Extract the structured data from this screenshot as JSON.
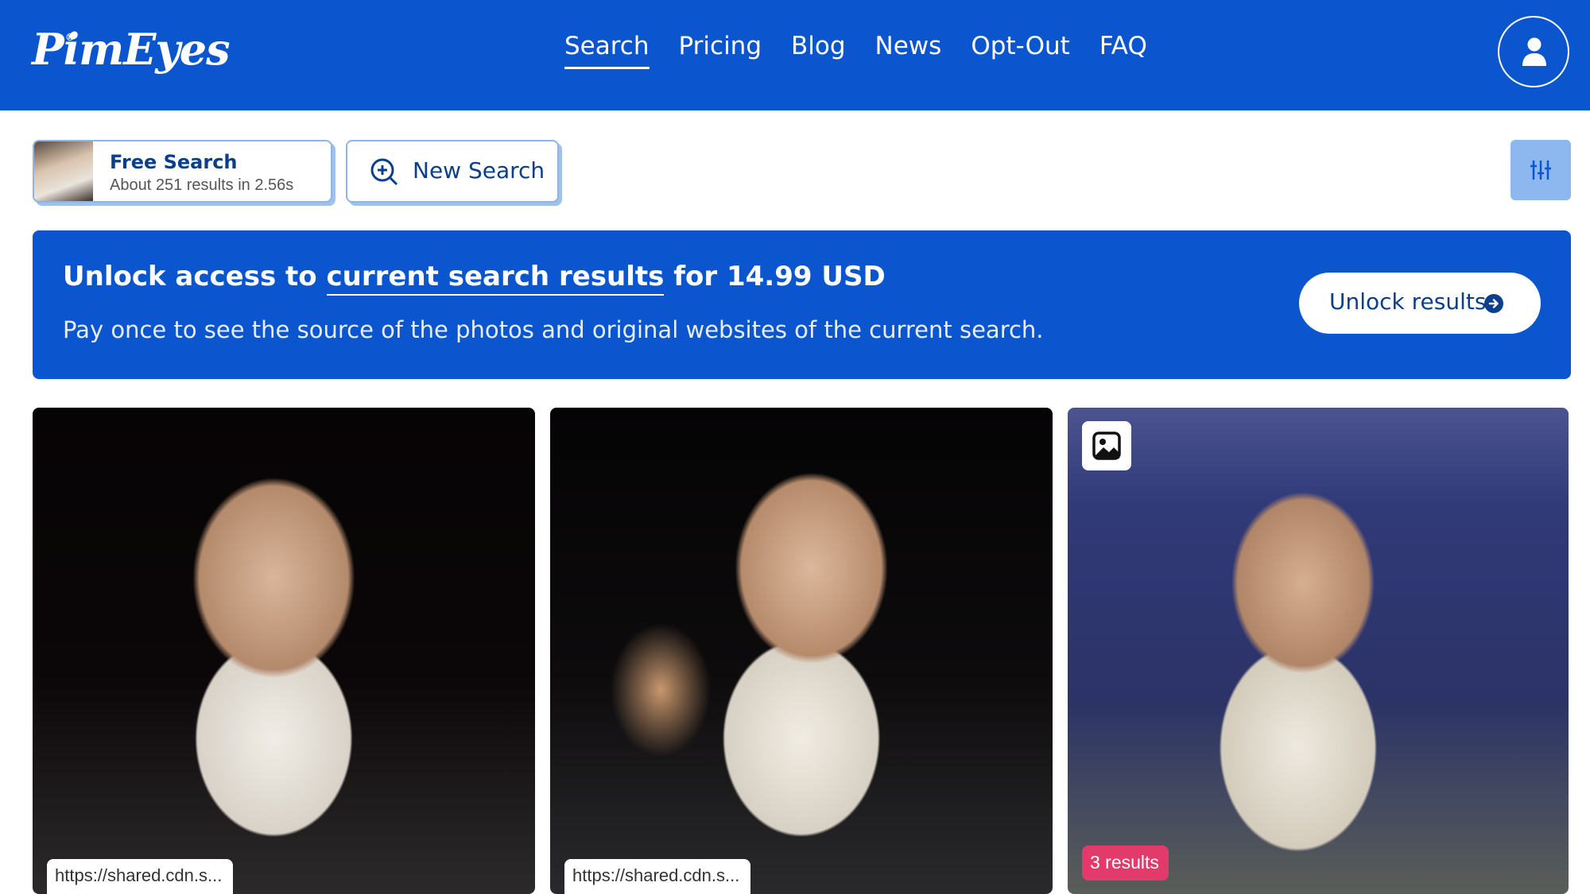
{
  "header": {
    "logo": "PimEyes",
    "logo_mark": "®",
    "nav": [
      {
        "label": "Search",
        "active": true
      },
      {
        "label": "Pricing"
      },
      {
        "label": "Blog"
      },
      {
        "label": "News"
      },
      {
        "label": "Opt-Out"
      },
      {
        "label": "FAQ"
      }
    ],
    "profile_icon": "user-icon"
  },
  "toolbar": {
    "free_search": {
      "title": "Free Search",
      "subtitle": "About 251 results in 2.56s"
    },
    "new_search_label": "New Search",
    "filter_icon": "sliders-icon"
  },
  "banner": {
    "headline_pre": "Unlock access to ",
    "headline_link": "current search results",
    "headline_post": " for 14.99 USD",
    "description": "Pay once to see the source of the photos and original websites of the current search.",
    "button_label": "Unlock results"
  },
  "results": [
    {
      "url": "https://shared.cdn.s..."
    },
    {
      "url": "https://shared.cdn.s..."
    },
    {
      "badge": "3 results",
      "icon": "image-icon"
    }
  ],
  "colors": {
    "brand_blue": "#0b56cf",
    "badge_pink": "#e23b6b",
    "filter_button": "#8db7ef"
  }
}
